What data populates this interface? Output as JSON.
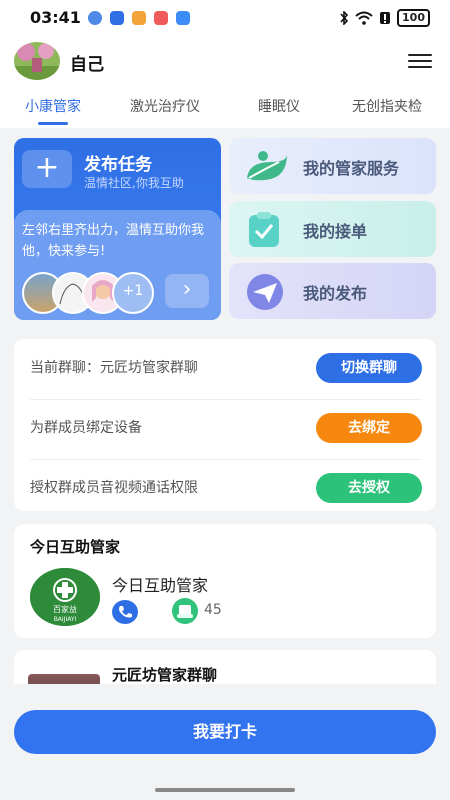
{
  "status_bar": {
    "time": "03:41",
    "battery": "100"
  },
  "header": {
    "title": "自己"
  },
  "tabs": [
    {
      "label": "小康管家",
      "active": true
    },
    {
      "label": "激光治疗仪"
    },
    {
      "label": "睡眠仪"
    },
    {
      "label": "无创指夹检"
    }
  ],
  "task_card": {
    "plus_icon": "+",
    "title": "发布任务",
    "subtitle": "温情社区,你我互助",
    "description": "左邻右里齐出力，温情互助你我他，快来参与!",
    "extra_count": "+1",
    "more_icon": "›"
  },
  "services": [
    {
      "label": "我的管家服务",
      "icon": "leaf-icon",
      "bg": "#dfe6fb"
    },
    {
      "label": "我的接单",
      "icon": "clipboard-icon",
      "bg": "#d4f3f0"
    },
    {
      "label": "我的发布",
      "icon": "paper-plane-icon",
      "bg": "#dcdcf8"
    }
  ],
  "group": {
    "rows": [
      {
        "label": "当前群聊：元匠坊管家群聊",
        "button": "切换群聊",
        "color": "#2f6fe6"
      },
      {
        "label": "为群成员绑定设备",
        "button": "去绑定",
        "color": "#f7880f"
      },
      {
        "label": "授权群成员音视频通话权限",
        "button": "去授权",
        "color": "#2cc27a"
      }
    ]
  },
  "today": {
    "section_title": "今日互助管家",
    "name": "今日互助管家",
    "count": "45",
    "badge_text": "百家益",
    "badge_sub": "BAIJIAYI"
  },
  "chat": {
    "name": "元匠坊管家群聊"
  },
  "footer": {
    "checkin_label": "我要打卡"
  },
  "colors": {
    "accent": "#2f6fe6",
    "orange": "#f7880f",
    "green": "#2cc27a"
  }
}
